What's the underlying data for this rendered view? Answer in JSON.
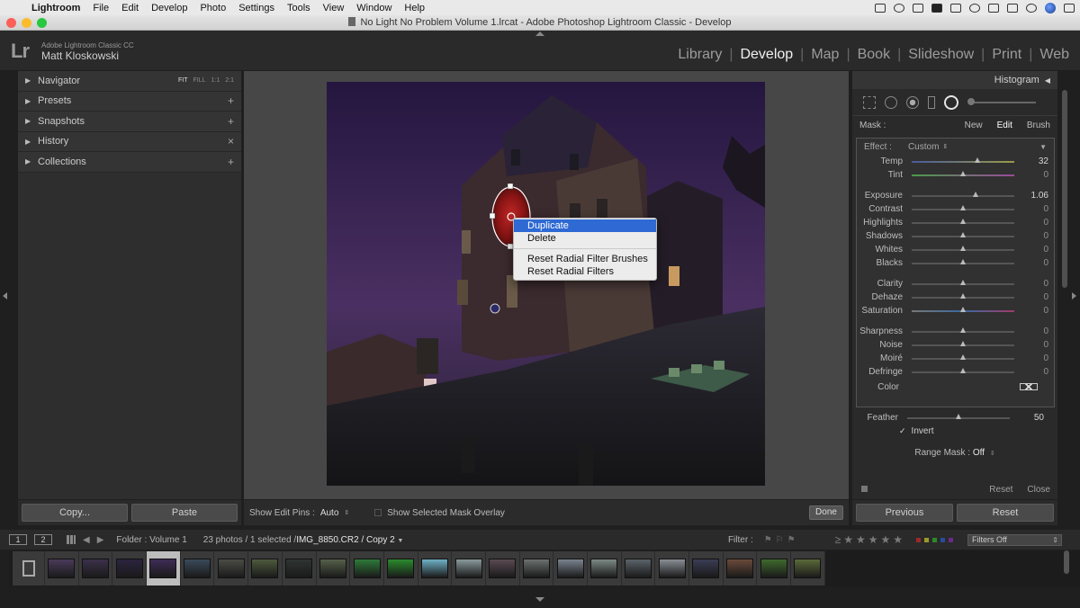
{
  "menubar": {
    "items": [
      "Lightroom",
      "File",
      "Edit",
      "Develop",
      "Photo",
      "Settings",
      "Tools",
      "View",
      "Window",
      "Help"
    ]
  },
  "window": {
    "title": "No Light No Problem Volume 1.lrcat - Adobe Photoshop Lightroom Classic - Develop"
  },
  "identity": {
    "logo": "Lr",
    "product": "Adobe Lightroom Classic CC",
    "user": "Matt Kloskowski"
  },
  "modules": {
    "items": [
      "Library",
      "Develop",
      "Map",
      "Book",
      "Slideshow",
      "Print",
      "Web"
    ],
    "active": "Develop"
  },
  "left_panel": {
    "navigator": {
      "label": "Navigator",
      "zoom": [
        "FIT",
        "FILL",
        "1:1",
        "2:1"
      ]
    },
    "presets": {
      "label": "Presets",
      "action": "+"
    },
    "snapshots": {
      "label": "Snapshots",
      "action": "+"
    },
    "history": {
      "label": "History",
      "action": "×"
    },
    "collections": {
      "label": "Collections",
      "action": "+"
    },
    "copy_label": "Copy...",
    "paste_label": "Paste"
  },
  "context_menu": {
    "items": [
      "Duplicate",
      "Delete",
      "Reset Radial Filter Brushes",
      "Reset Radial Filters"
    ],
    "highlighted": "Duplicate"
  },
  "toolbar": {
    "edit_pins_label": "Show Edit Pins :",
    "edit_pins_value": "Auto",
    "overlay_label": "Show Selected Mask Overlay",
    "done_label": "Done"
  },
  "right_panel": {
    "histogram_label": "Histogram",
    "mask_label": "Mask :",
    "mask_new": "New",
    "mask_edit": "Edit",
    "mask_brush": "Brush",
    "effect_label": "Effect :",
    "effect_value": "Custom",
    "sliders": [
      {
        "name": "Temp",
        "value": "32",
        "pos": 0.64,
        "active": true
      },
      {
        "name": "Tint",
        "value": "0",
        "pos": 0.5,
        "active": false
      },
      {
        "name": "Exposure",
        "value": "1.06",
        "pos": 0.62,
        "active": true
      },
      {
        "name": "Contrast",
        "value": "0",
        "pos": 0.5,
        "active": false
      },
      {
        "name": "Highlights",
        "value": "0",
        "pos": 0.5,
        "active": false
      },
      {
        "name": "Shadows",
        "value": "0",
        "pos": 0.5,
        "active": false
      },
      {
        "name": "Whites",
        "value": "0",
        "pos": 0.5,
        "active": false
      },
      {
        "name": "Blacks",
        "value": "0",
        "pos": 0.5,
        "active": false
      },
      {
        "name": "Clarity",
        "value": "0",
        "pos": 0.5,
        "active": false
      },
      {
        "name": "Dehaze",
        "value": "0",
        "pos": 0.5,
        "active": false
      },
      {
        "name": "Saturation",
        "value": "0",
        "pos": 0.5,
        "active": false
      },
      {
        "name": "Sharpness",
        "value": "0",
        "pos": 0.5,
        "active": false
      },
      {
        "name": "Noise",
        "value": "0",
        "pos": 0.5,
        "active": false
      },
      {
        "name": "Moiré",
        "value": "0",
        "pos": 0.5,
        "active": false
      },
      {
        "name": "Defringe",
        "value": "0",
        "pos": 0.5,
        "active": false
      }
    ],
    "color_label": "Color",
    "feather_label": "Feather",
    "feather_value": "50",
    "feather_pos": 0.5,
    "invert_label": "Invert",
    "range_mask_label": "Range Mask :",
    "range_mask_value": "Off",
    "reset_label": "Reset",
    "close_label": "Close",
    "previous_label": "Previous",
    "reset_button_label": "Reset"
  },
  "filmstrip": {
    "page1": "1",
    "page2": "2",
    "folder": "Folder : Volume 1",
    "count": "23 photos / 1 selected /",
    "filename": "IMG_8850.CR2 / Copy 2",
    "filter_label": "Filter :",
    "filters_off": "Filters Off",
    "thumb_colors": [
      "#4a3b5b",
      "#3b3149",
      "#2c243f",
      "#3e2c55",
      "#3a4a5a",
      "#4b4b46",
      "#4e5a3e",
      "#2f3533",
      "#55604a",
      "#2f7a3a",
      "#2b8a2e",
      "#6fb0c6",
      "#8a9a9c",
      "#5a4a52",
      "#6b7270",
      "#7a8490",
      "#7d8a86",
      "#5b636a",
      "#8a8f96",
      "#3a3d54",
      "#6a4a3a",
      "#3f6a2e",
      "#5b6a3a"
    ],
    "selected_index": 3
  }
}
